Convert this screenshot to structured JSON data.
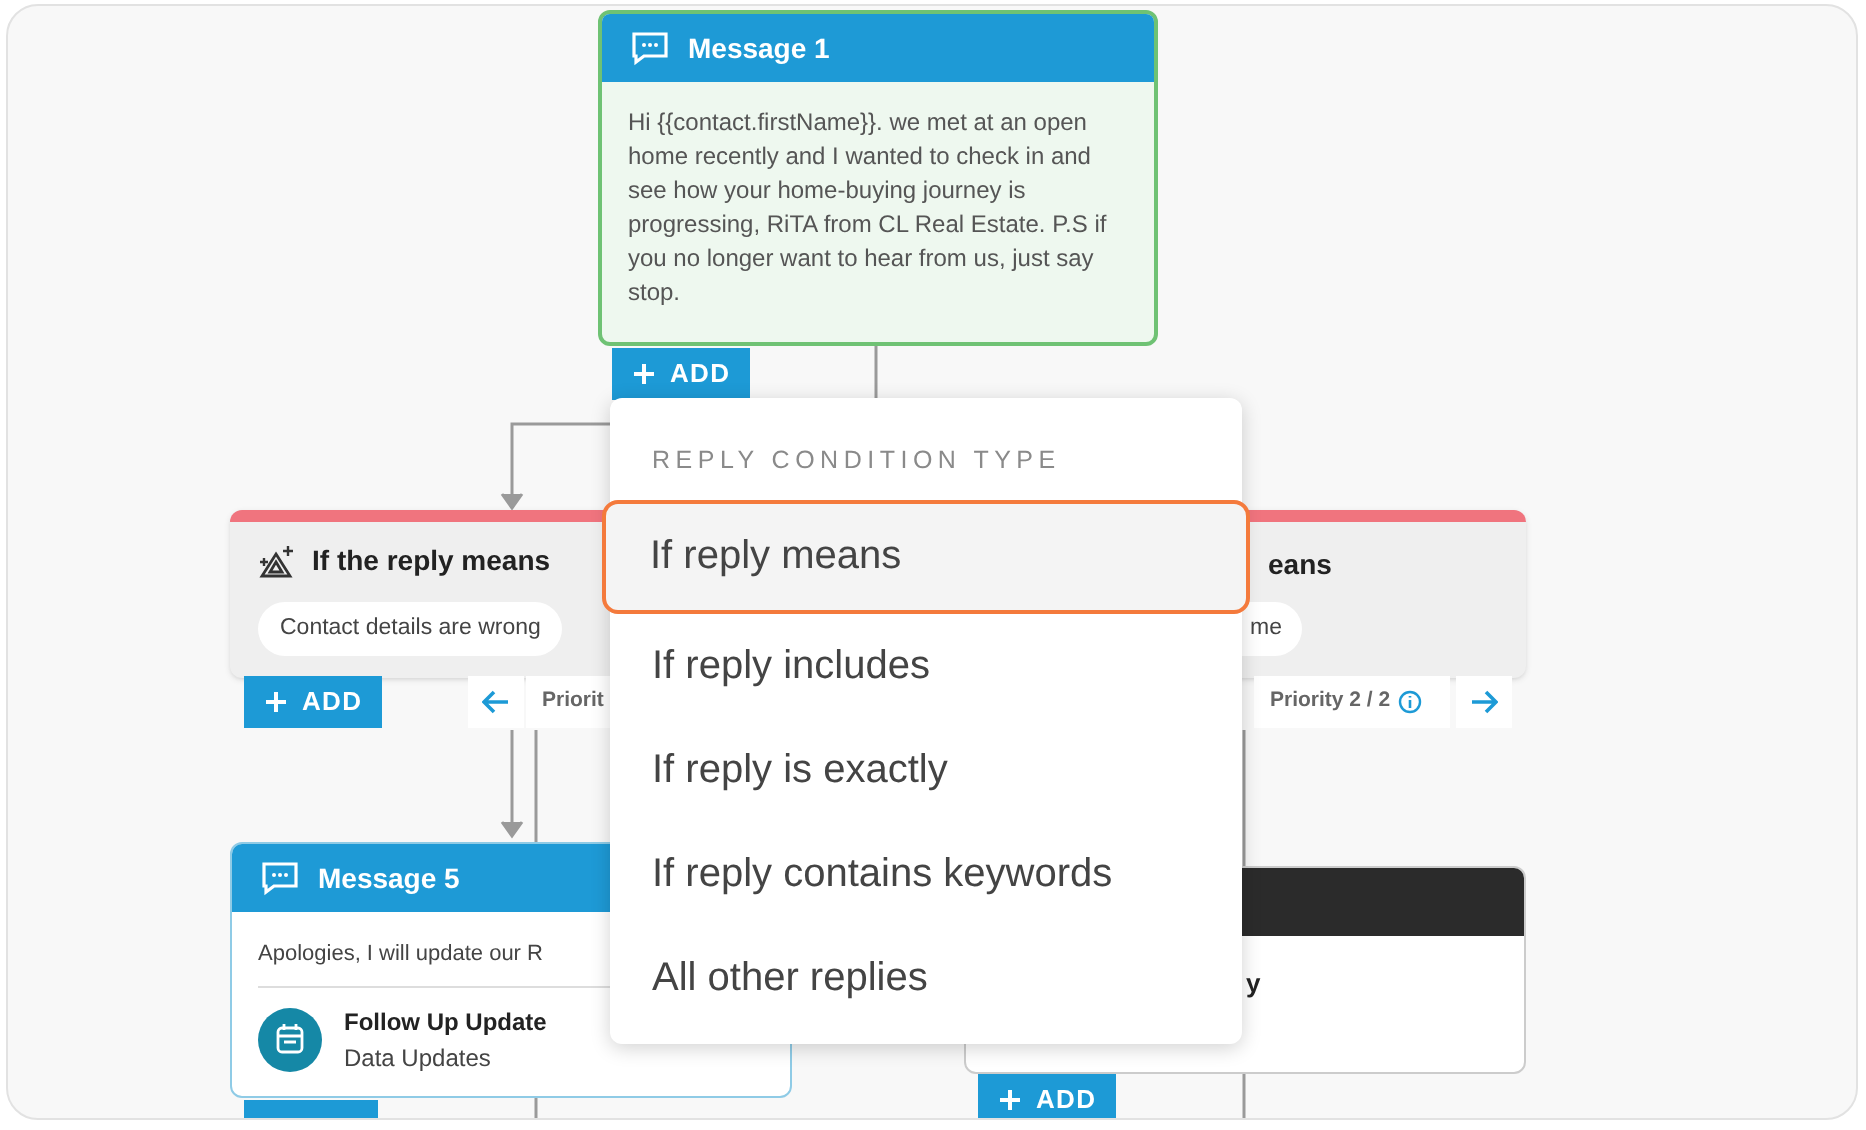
{
  "message_1": {
    "title": "Message 1",
    "text": "Hi {{contact.firstName}}. we met at an open home recently and I wanted to check in and see how your home-buying journey is progressing, RiTA from CL Real Estate. P.S if you no longer want to hear from us, just say stop.",
    "add_button": "ADD"
  },
  "condition_left": {
    "title": "If the reply means",
    "chip": "Contact details are wrong",
    "add_button": "ADD",
    "priority": "Priorit"
  },
  "condition_right": {
    "title": "eans",
    "chip": "me",
    "priority": "Priority 2 / 2"
  },
  "message_5": {
    "title": "Message 5",
    "text": "Apologies, I will update our R",
    "action_title": "Follow Up Update",
    "action_subtitle": "Data Updates"
  },
  "node_right": {
    "text": "y",
    "add_button": "ADD"
  },
  "menu": {
    "heading": "REPLY CONDITION TYPE",
    "items": [
      {
        "label": "If reply means",
        "selected": true
      },
      {
        "label": "If reply includes",
        "selected": false
      },
      {
        "label": "If reply is exactly",
        "selected": false
      },
      {
        "label": "If reply contains keywords",
        "selected": false
      },
      {
        "label": "All other replies",
        "selected": false
      }
    ]
  }
}
